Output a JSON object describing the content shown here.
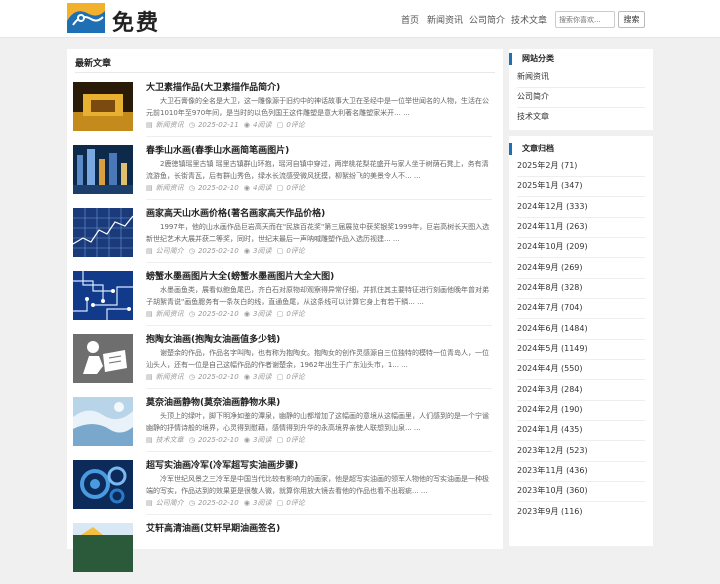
{
  "header": {
    "site_name": "免费",
    "nav": [
      "首页",
      "新闻资讯",
      "公司简介",
      "技术文章"
    ],
    "search_placeholder": "搜索你喜欢...",
    "search_button": "搜索"
  },
  "main": {
    "title": "最新文章",
    "articles": [
      {
        "title": "大卫素描作品(大卫素描作品简介)",
        "desc": "大卫石膏像的全名是大卫，这一雕像源于旧约中的神话故事大卫在圣经中是一位举世闻名的人物，生活在公元前1010年至970年间，是当时的以色列国王这件雕塑是意大利著名雕塑家米开... ...",
        "category": "新闻资讯",
        "date": "2025-02-11",
        "views": "4阅读",
        "comments": "0评论"
      },
      {
        "title": "春季山水画(春季山水画简笔画图片)",
        "desc": "2鹿徳镇瑶里古镇 瑶里古镇群山环抱，瑶河自镇中穿过，两岸桃花梨花盛开与家人坐于树荫石凳上，务有清流游鱼，长街青瓦，后有群山秀色，绿水长流感受微风抚摸，柳絮纷飞的美景令人不... ...",
        "category": "新闻资讯",
        "date": "2025-02-10",
        "views": "4阅读",
        "comments": "0评论"
      },
      {
        "title": "画家高天山水画价格(著名画家高天作品价格)",
        "desc": "1997年，他的山水画作品巨岩高天而在\"民族百花奖\"第三届展览中获奖银奖1999年，巨岩高树长天图入选新世纪艺术大展并获二等奖，同时，世纪末最后一声呐喊雕塑作品入选历视建... ...",
        "category": "公司简介",
        "date": "2025-02-10",
        "views": "3阅读",
        "comments": "0评论"
      },
      {
        "title": "螃蟹水墨画图片大全(螃蟹水墨画图片大全大图)",
        "desc": "水墨画鱼类，展看似鲍鱼尾巴，齐白石对原物却观察得异常仔细，并抓住其主要特征进行刻画他晚年曾对弟子胡絮青说\"画鱼腮务有一条灰白的线，直通鱼尾，从这条线可以计算它身上有若干鳞... ...",
        "category": "新闻资讯",
        "date": "2025-02-10",
        "views": "3阅读",
        "comments": "0评论"
      },
      {
        "title": "抱陶女油画(抱陶女油画值多少钱)",
        "desc": "谢楚余的作品，作品名字叫陶，也有称为抱陶女。抱陶女的创作灵感源自三位独特的模特一位青岛人，一位汕头人，还有一位是自己这幅作品的作者谢楚余，1962年出生于广东汕头市，1... ...",
        "category": "新闻资讯",
        "date": "2025-02-10",
        "views": "3阅读",
        "comments": "0评论"
      },
      {
        "title": "莫奈油画静物(莫奈油画静物水果)",
        "desc": "头顶上的绿叶，脚下明净如鉴的潭泉，幽静的山都增加了这幅画的意境从这幅画里，人们感到的是一个宁谧幽静的抒情诗般的境界，心灵得到慰藉，感情得到升华的永高境界亲使人联想到山泉... ...",
        "category": "技术文章",
        "date": "2025-02-10",
        "views": "3阅读",
        "comments": "0评论"
      },
      {
        "title": "超写实油画冷军(冷军超写实油画步骤)",
        "desc": "冷军世纪风景之三冷军是中国当代比较有影响力的画家，他是超写实油画的领军人物他的写实油画是一种极端的写实，作品达到的效果更是很敬人微，就算你用放大镜去看他的作品也看不出瑕疵... ...",
        "category": "公司简介",
        "date": "2025-02-10",
        "views": "3阅读",
        "comments": "0评论"
      },
      {
        "title": "艾轩高清油画(艾轩早期油画签名)",
        "desc": "",
        "category": "",
        "date": "",
        "views": "",
        "comments": ""
      }
    ]
  },
  "sidebar": {
    "categories_title": "网站分类",
    "categories": [
      "新闻资讯",
      "公司简介",
      "技术文章"
    ],
    "archive_title": "文章归档",
    "archive": [
      "2025年2月 (71)",
      "2025年1月 (347)",
      "2024年12月 (333)",
      "2024年11月 (263)",
      "2024年10月 (209)",
      "2024年9月 (269)",
      "2024年8月 (328)",
      "2024年7月 (704)",
      "2024年6月 (1484)",
      "2024年5月 (1149)",
      "2024年4月 (550)",
      "2024年3月 (284)",
      "2024年2月 (190)",
      "2024年1月 (435)",
      "2023年12月 (523)",
      "2023年11月 (436)",
      "2023年10月 (360)",
      "2023年9月 (116)"
    ]
  }
}
